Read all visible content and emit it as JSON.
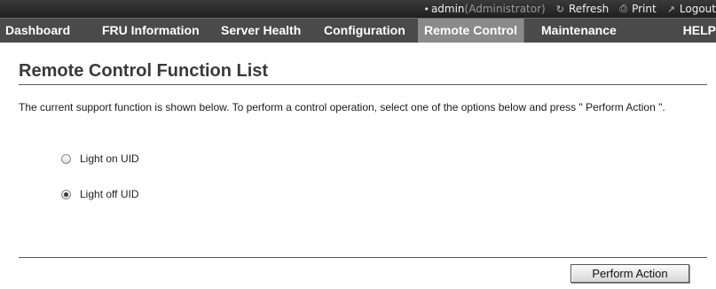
{
  "header": {
    "user_name": "admin",
    "user_role": "(Administrator)",
    "refresh_label": "Refresh",
    "print_label": "Print",
    "logout_label": "Logout"
  },
  "nav": {
    "tabs": [
      {
        "label": "Dashboard",
        "active": false
      },
      {
        "label": "FRU Information",
        "active": false
      },
      {
        "label": "Server Health",
        "active": false
      },
      {
        "label": "Configuration",
        "active": false
      },
      {
        "label": "Remote Control",
        "active": true
      },
      {
        "label": "Maintenance",
        "active": false
      },
      {
        "label": "HELP",
        "active": false
      }
    ]
  },
  "page": {
    "title": "Remote Control Function List",
    "description": "The current support function is shown below. To perform a control operation, select one of the options below and press \" Perform Action \".",
    "options": [
      {
        "label": "Light on UID",
        "selected": false
      },
      {
        "label": "Light off UID",
        "selected": true
      }
    ],
    "perform_button_label": "Perform Action"
  }
}
